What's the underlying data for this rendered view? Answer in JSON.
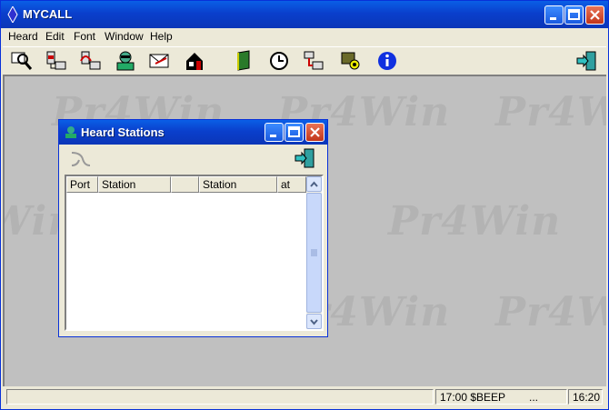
{
  "window": {
    "title": "MYCALL"
  },
  "menu": [
    "Heard",
    "Edit",
    "Font",
    "Window",
    "Help"
  ],
  "toolbar": {
    "tools": [
      "monitor-search-icon",
      "connect-icon",
      "disconnect-icon",
      "operator-icon",
      "mail-icon",
      "home-icon",
      "book-icon",
      "clock-icon",
      "network-icon",
      "settings-icon",
      "info-icon",
      "exit-icon"
    ]
  },
  "watermark": "Pr4Win",
  "heard_window": {
    "title": "Heard Stations",
    "columns": [
      "Port",
      "Station",
      "",
      "Station",
      "at"
    ]
  },
  "status": {
    "beacon": "17:00 $BEEP",
    "dots": "...",
    "time": "16:20"
  }
}
